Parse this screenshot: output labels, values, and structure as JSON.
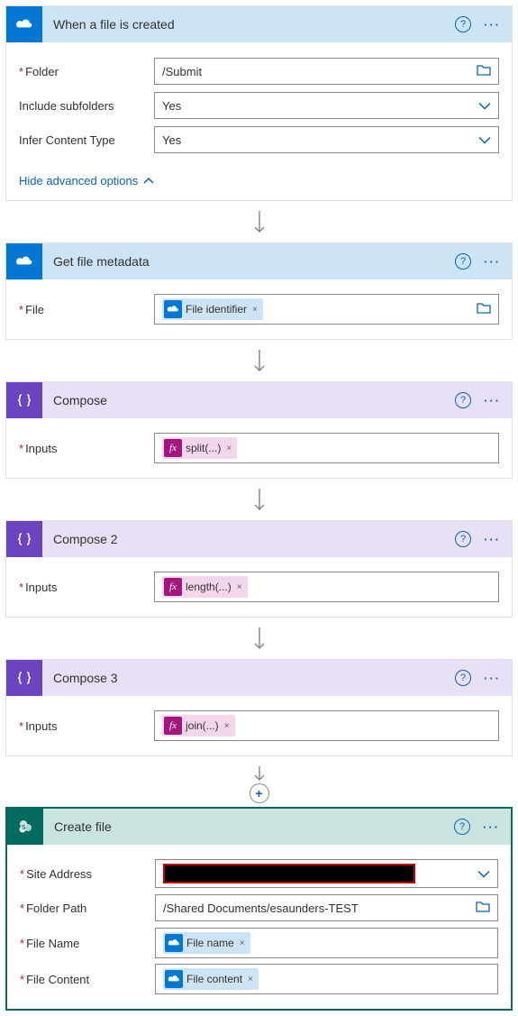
{
  "cards": {
    "trigger": {
      "title": "When a file is created",
      "fields": {
        "folder_label": "Folder",
        "folder_value": "/Submit",
        "sub_label": "Include subfolders",
        "sub_value": "Yes",
        "ct_label": "Infer Content Type",
        "ct_value": "Yes"
      },
      "advanced": "Hide advanced options"
    },
    "getmeta": {
      "title": "Get file metadata",
      "file_label": "File",
      "token": "File identifier"
    },
    "c1": {
      "title": "Compose",
      "inputs_label": "Inputs",
      "token": "split(...)"
    },
    "c2": {
      "title": "Compose 2",
      "inputs_label": "Inputs",
      "token": "length(...)"
    },
    "c3": {
      "title": "Compose 3",
      "inputs_label": "Inputs",
      "token": "join(...)"
    },
    "create": {
      "title": "Create file",
      "site_label": "Site Address",
      "fp_label": "Folder Path",
      "fp_value": "/Shared Documents/esaunders-TEST",
      "fn_label": "File Name",
      "fn_token": "File name",
      "fc_label": "File Content",
      "fc_token": "File content"
    }
  },
  "glyphs": {
    "x": "×",
    "plus": "+",
    "help": "?"
  }
}
